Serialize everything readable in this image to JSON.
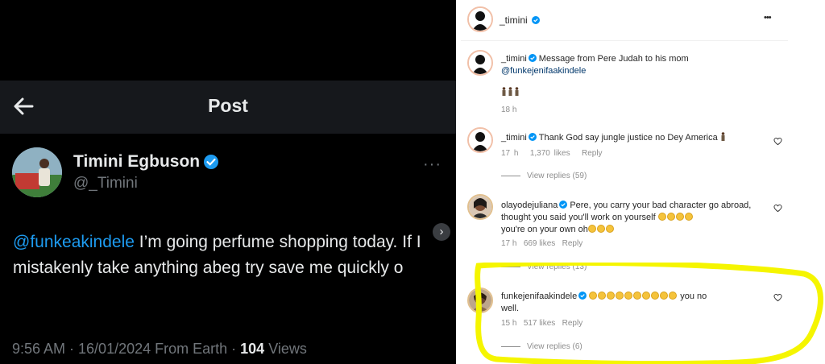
{
  "twitter": {
    "page_title": "Post",
    "author_name": "Timini Egbuson",
    "author_handle": "@_Timini",
    "tweet_mention": "@funkeakindele",
    "tweet_text": " I’m going perfume shopping today. If I mistakenly take anything abeg try save me quickly o",
    "meta_time": "9:56 AM · 16/01/2024 From Earth · ",
    "meta_views_count": "104",
    "meta_views_label": " Views",
    "more_label": "···"
  },
  "instagram": {
    "header_username": "_timini",
    "header_more": "•••",
    "caption": {
      "username": "_timini",
      "text": "Message from Pere Judah to his mom",
      "mention": "@funkejenifaakindele",
      "time": "18 h"
    },
    "comments": [
      {
        "username": "_timini",
        "text": "Thank God say jungle justice no Dey America",
        "time": "17 h",
        "likes": "1,370 likes",
        "reply": "Reply",
        "view_replies": "View replies (59)"
      },
      {
        "username": "olayodejuliana",
        "text": "Pere, you carry your bad character go abroad, thought you said you'll work on yourself",
        "text2": "you're on your own oh",
        "time": "17 h",
        "likes": "669 likes",
        "reply": "Reply",
        "view_replies": "View replies (13)"
      },
      {
        "username": "funkejenifaakindele",
        "text": "you no",
        "text2": "well.",
        "time": "15 h",
        "likes": "517 likes",
        "reply": "Reply",
        "view_replies": "View replies (6)"
      }
    ]
  },
  "colors": {
    "twitter_bg": "#000000",
    "twitter_link": "#1d9bf0",
    "verified_blue": "#0095f6",
    "highlight": "#f5f500"
  }
}
